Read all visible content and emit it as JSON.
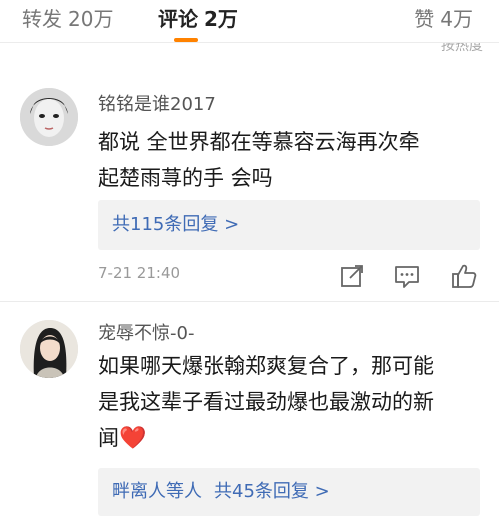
{
  "tabs": {
    "repost": {
      "label": "转发",
      "count": "20万"
    },
    "comments": {
      "label": "评论",
      "count": "2万"
    },
    "likes": {
      "label": "赞",
      "count": "4万"
    }
  },
  "sort_hint": "按热度",
  "colors": {
    "accent": "#ff8200",
    "link": "#3f6bb5",
    "heart": "#e8323c"
  },
  "comments": [
    {
      "username": "铭铭是谁2017",
      "text_lines": [
        "都说 全世界都在等慕容云海再次牵",
        "起楚雨荨的手 会吗"
      ],
      "reply_summary": "共115条回复 >",
      "timestamp": "7-21 21:40",
      "icons": [
        "share-icon",
        "comment-icon",
        "thumbs-up-icon"
      ]
    },
    {
      "username": "宠辱不惊-0-",
      "text_lines": [
        "如果哪天爆张翰郑爽复合了，那可能",
        "是我这辈子看过最劲爆也最激动的新",
        "闻"
      ],
      "emoji": "❤️",
      "reply_users": "畔离人等人",
      "reply_summary": "共45条回复 >"
    }
  ]
}
